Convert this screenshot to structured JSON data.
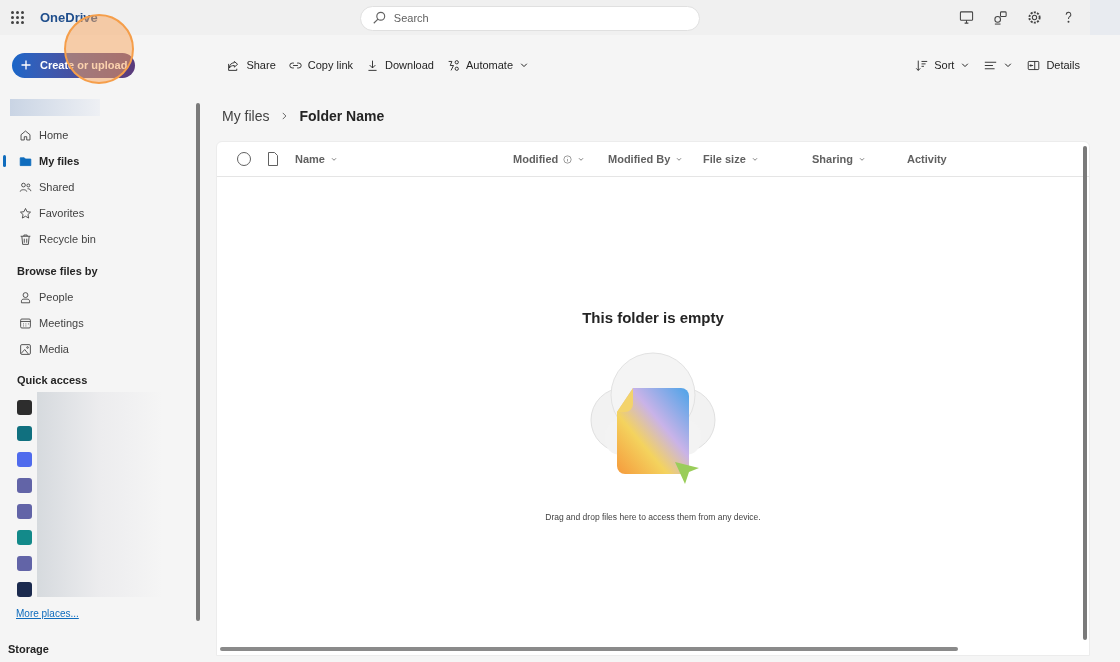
{
  "app": {
    "name": "OneDrive"
  },
  "search": {
    "placeholder": "Search"
  },
  "header_icons": [
    {
      "kind": "monitor"
    },
    {
      "kind": "community"
    },
    {
      "kind": "settings"
    },
    {
      "kind": "help"
    }
  ],
  "create_button": {
    "label": "Create or upload"
  },
  "toolbar": [
    {
      "kind": "share",
      "label": "Share",
      "menu": false
    },
    {
      "kind": "link",
      "label": "Copy link",
      "menu": false
    },
    {
      "kind": "download",
      "label": "Download",
      "menu": false
    },
    {
      "kind": "automate",
      "label": "Automate",
      "menu": true
    }
  ],
  "view_controls": [
    {
      "kind": "sort",
      "label": "Sort",
      "menu": true
    },
    {
      "kind": "view",
      "menu": true
    },
    {
      "kind": "details",
      "label": "Details",
      "menu": false
    }
  ],
  "nav": [
    {
      "kind": "home",
      "label": "Home",
      "selected": false
    },
    {
      "kind": "folder",
      "label": "My files",
      "selected": true
    },
    {
      "kind": "shared",
      "label": "Shared",
      "selected": false
    },
    {
      "kind": "star",
      "label": "Favorites",
      "selected": false
    },
    {
      "kind": "trash",
      "label": "Recycle bin",
      "selected": false
    }
  ],
  "browse": {
    "heading": "Browse files by",
    "items": [
      {
        "kind": "people",
        "label": "People"
      },
      {
        "kind": "calendar",
        "label": "Meetings"
      },
      {
        "kind": "image",
        "label": "Media"
      }
    ]
  },
  "quick_access": {
    "heading": "Quick access",
    "items": [
      {
        "color": "#2d2d2d"
      },
      {
        "color": "#10707f"
      },
      {
        "color": "#4f6bed"
      },
      {
        "color": "#6264a7"
      },
      {
        "color": "#6264a7"
      },
      {
        "color": "#138a8a"
      },
      {
        "color": "#6264a7"
      },
      {
        "color": "#1b2a4e"
      }
    ],
    "more_link": "More places..."
  },
  "storage": {
    "heading": "Storage"
  },
  "breadcrumb": [
    {
      "label": "My files",
      "current": false
    },
    {
      "label": "Folder Name",
      "current": true
    }
  ],
  "table": {
    "select_all": {
      "checked": false
    },
    "columns": [
      {
        "label": "Name",
        "info": false,
        "menu": true
      },
      {
        "label": "Modified",
        "info": true,
        "menu": true
      },
      {
        "label": "Modified By",
        "info": false,
        "menu": true
      },
      {
        "label": "File size",
        "info": false,
        "menu": true
      },
      {
        "label": "Sharing",
        "info": false,
        "menu": true
      },
      {
        "label": "Activity",
        "info": false,
        "menu": false
      }
    ]
  },
  "empty_state": {
    "title": "This folder is empty",
    "hint": "Drag and drop files here to access them from any device."
  }
}
